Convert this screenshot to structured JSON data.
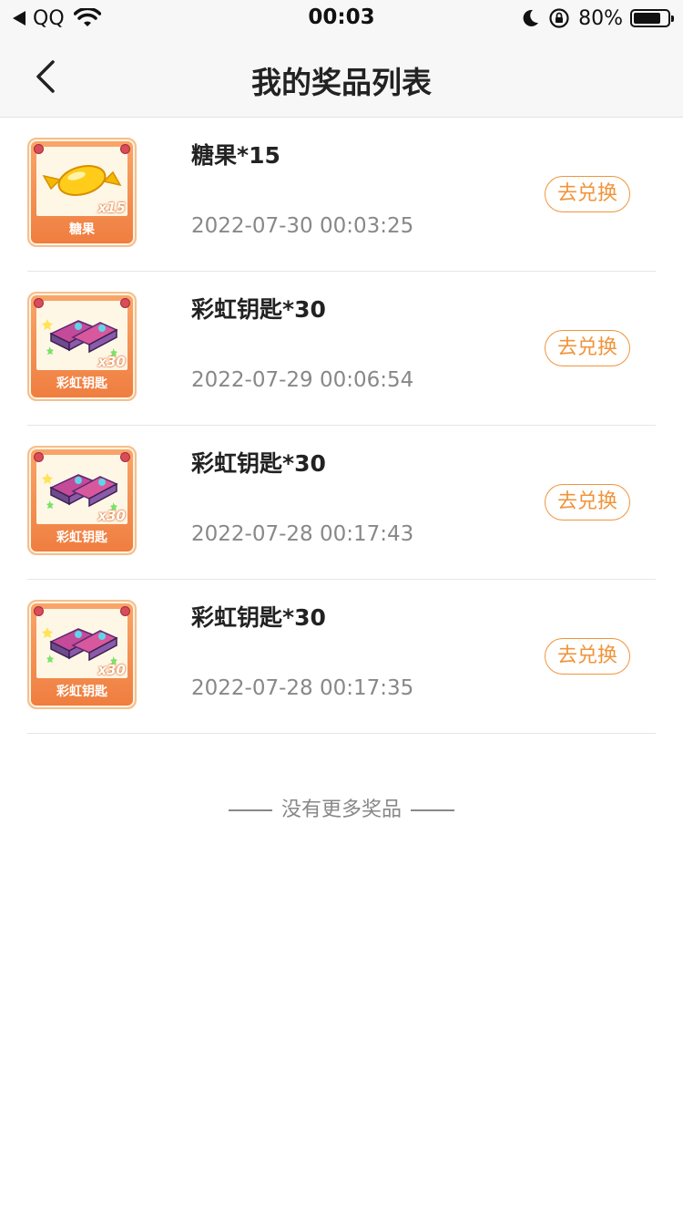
{
  "status_bar": {
    "carrier": "QQ",
    "time": "00:03",
    "battery": "80%",
    "battery_level": 0.8
  },
  "nav": {
    "title": "我的奖品列表",
    "back_icon": "chevron-left-icon"
  },
  "prizes": [
    {
      "title": "糖果*15",
      "date": "2022-07-30 00:03:25",
      "button": "去兑换",
      "thumb_label": "糖果",
      "thumb_qty": "x15",
      "art": "candy"
    },
    {
      "title": "彩虹钥匙*30",
      "date": "2022-07-29 00:06:54",
      "button": "去兑换",
      "thumb_label": "彩虹钥匙",
      "thumb_qty": "x30",
      "art": "keys"
    },
    {
      "title": "彩虹钥匙*30",
      "date": "2022-07-28 00:17:43",
      "button": "去兑换",
      "thumb_label": "彩虹钥匙",
      "thumb_qty": "x30",
      "art": "keys"
    },
    {
      "title": "彩虹钥匙*30",
      "date": "2022-07-28 00:17:35",
      "button": "去兑换",
      "thumb_label": "彩虹钥匙",
      "thumb_qty": "x30",
      "art": "keys"
    }
  ],
  "footer": {
    "text": "没有更多奖品"
  },
  "colors": {
    "accent": "#f0943a",
    "nav_bg": "#f7f7f7",
    "date_text": "#888888"
  }
}
